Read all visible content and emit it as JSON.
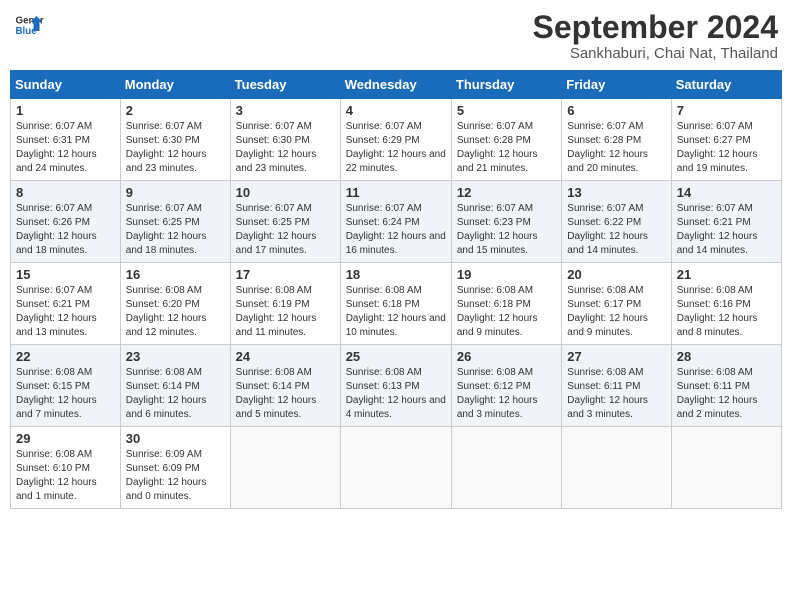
{
  "header": {
    "logo_line1": "General",
    "logo_line2": "Blue",
    "month_year": "September 2024",
    "location": "Sankhaburi, Chai Nat, Thailand"
  },
  "days_of_week": [
    "Sunday",
    "Monday",
    "Tuesday",
    "Wednesday",
    "Thursday",
    "Friday",
    "Saturday"
  ],
  "weeks": [
    [
      {
        "day": "1",
        "sunrise": "Sunrise: 6:07 AM",
        "sunset": "Sunset: 6:31 PM",
        "daylight": "Daylight: 12 hours and 24 minutes."
      },
      {
        "day": "2",
        "sunrise": "Sunrise: 6:07 AM",
        "sunset": "Sunset: 6:30 PM",
        "daylight": "Daylight: 12 hours and 23 minutes."
      },
      {
        "day": "3",
        "sunrise": "Sunrise: 6:07 AM",
        "sunset": "Sunset: 6:30 PM",
        "daylight": "Daylight: 12 hours and 23 minutes."
      },
      {
        "day": "4",
        "sunrise": "Sunrise: 6:07 AM",
        "sunset": "Sunset: 6:29 PM",
        "daylight": "Daylight: 12 hours and 22 minutes."
      },
      {
        "day": "5",
        "sunrise": "Sunrise: 6:07 AM",
        "sunset": "Sunset: 6:28 PM",
        "daylight": "Daylight: 12 hours and 21 minutes."
      },
      {
        "day": "6",
        "sunrise": "Sunrise: 6:07 AM",
        "sunset": "Sunset: 6:28 PM",
        "daylight": "Daylight: 12 hours and 20 minutes."
      },
      {
        "day": "7",
        "sunrise": "Sunrise: 6:07 AM",
        "sunset": "Sunset: 6:27 PM",
        "daylight": "Daylight: 12 hours and 19 minutes."
      }
    ],
    [
      {
        "day": "8",
        "sunrise": "Sunrise: 6:07 AM",
        "sunset": "Sunset: 6:26 PM",
        "daylight": "Daylight: 12 hours and 18 minutes."
      },
      {
        "day": "9",
        "sunrise": "Sunrise: 6:07 AM",
        "sunset": "Sunset: 6:25 PM",
        "daylight": "Daylight: 12 hours and 18 minutes."
      },
      {
        "day": "10",
        "sunrise": "Sunrise: 6:07 AM",
        "sunset": "Sunset: 6:25 PM",
        "daylight": "Daylight: 12 hours and 17 minutes."
      },
      {
        "day": "11",
        "sunrise": "Sunrise: 6:07 AM",
        "sunset": "Sunset: 6:24 PM",
        "daylight": "Daylight: 12 hours and 16 minutes."
      },
      {
        "day": "12",
        "sunrise": "Sunrise: 6:07 AM",
        "sunset": "Sunset: 6:23 PM",
        "daylight": "Daylight: 12 hours and 15 minutes."
      },
      {
        "day": "13",
        "sunrise": "Sunrise: 6:07 AM",
        "sunset": "Sunset: 6:22 PM",
        "daylight": "Daylight: 12 hours and 14 minutes."
      },
      {
        "day": "14",
        "sunrise": "Sunrise: 6:07 AM",
        "sunset": "Sunset: 6:21 PM",
        "daylight": "Daylight: 12 hours and 14 minutes."
      }
    ],
    [
      {
        "day": "15",
        "sunrise": "Sunrise: 6:07 AM",
        "sunset": "Sunset: 6:21 PM",
        "daylight": "Daylight: 12 hours and 13 minutes."
      },
      {
        "day": "16",
        "sunrise": "Sunrise: 6:08 AM",
        "sunset": "Sunset: 6:20 PM",
        "daylight": "Daylight: 12 hours and 12 minutes."
      },
      {
        "day": "17",
        "sunrise": "Sunrise: 6:08 AM",
        "sunset": "Sunset: 6:19 PM",
        "daylight": "Daylight: 12 hours and 11 minutes."
      },
      {
        "day": "18",
        "sunrise": "Sunrise: 6:08 AM",
        "sunset": "Sunset: 6:18 PM",
        "daylight": "Daylight: 12 hours and 10 minutes."
      },
      {
        "day": "19",
        "sunrise": "Sunrise: 6:08 AM",
        "sunset": "Sunset: 6:18 PM",
        "daylight": "Daylight: 12 hours and 9 minutes."
      },
      {
        "day": "20",
        "sunrise": "Sunrise: 6:08 AM",
        "sunset": "Sunset: 6:17 PM",
        "daylight": "Daylight: 12 hours and 9 minutes."
      },
      {
        "day": "21",
        "sunrise": "Sunrise: 6:08 AM",
        "sunset": "Sunset: 6:16 PM",
        "daylight": "Daylight: 12 hours and 8 minutes."
      }
    ],
    [
      {
        "day": "22",
        "sunrise": "Sunrise: 6:08 AM",
        "sunset": "Sunset: 6:15 PM",
        "daylight": "Daylight: 12 hours and 7 minutes."
      },
      {
        "day": "23",
        "sunrise": "Sunrise: 6:08 AM",
        "sunset": "Sunset: 6:14 PM",
        "daylight": "Daylight: 12 hours and 6 minutes."
      },
      {
        "day": "24",
        "sunrise": "Sunrise: 6:08 AM",
        "sunset": "Sunset: 6:14 PM",
        "daylight": "Daylight: 12 hours and 5 minutes."
      },
      {
        "day": "25",
        "sunrise": "Sunrise: 6:08 AM",
        "sunset": "Sunset: 6:13 PM",
        "daylight": "Daylight: 12 hours and 4 minutes."
      },
      {
        "day": "26",
        "sunrise": "Sunrise: 6:08 AM",
        "sunset": "Sunset: 6:12 PM",
        "daylight": "Daylight: 12 hours and 3 minutes."
      },
      {
        "day": "27",
        "sunrise": "Sunrise: 6:08 AM",
        "sunset": "Sunset: 6:11 PM",
        "daylight": "Daylight: 12 hours and 3 minutes."
      },
      {
        "day": "28",
        "sunrise": "Sunrise: 6:08 AM",
        "sunset": "Sunset: 6:11 PM",
        "daylight": "Daylight: 12 hours and 2 minutes."
      }
    ],
    [
      {
        "day": "29",
        "sunrise": "Sunrise: 6:08 AM",
        "sunset": "Sunset: 6:10 PM",
        "daylight": "Daylight: 12 hours and 1 minute."
      },
      {
        "day": "30",
        "sunrise": "Sunrise: 6:09 AM",
        "sunset": "Sunset: 6:09 PM",
        "daylight": "Daylight: 12 hours and 0 minutes."
      },
      null,
      null,
      null,
      null,
      null
    ]
  ]
}
